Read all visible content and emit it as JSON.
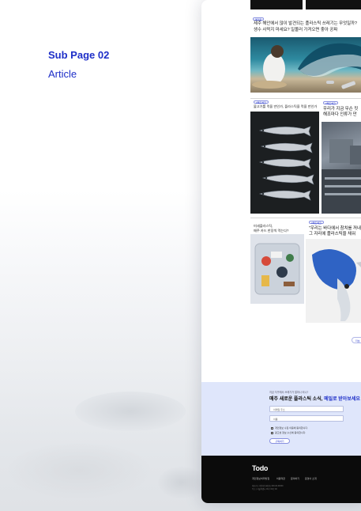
{
  "presentation": {
    "subpage_label": "Sub Page 02",
    "page_name": "Article"
  },
  "articles": {
    "first": {
      "tag": "매거진",
      "title_line1": "제주 해안에서 많이 발견되는 플라스틱 쓰레기는 무엇일까?",
      "title_line2": "생수 사먹지 마세요? 일몰러 가져오면 좋아 공짜"
    },
    "second_left": {
      "tag": "#팩트체크",
      "title": "불고기를 먹을 만인가, 플라스틱을 먹을 만인가"
    },
    "second_right": {
      "tag": "#팩트체크",
      "title_line1": "우리가 지금 무슨 짓",
      "title_line2": "해조마다 인류가 만"
    },
    "third_left": {
      "tag": "#팩트체크",
      "title_line1": "미세플라스틱,",
      "title_line2": "매주 카드 한장씩 먹는다?"
    },
    "third_right": {
      "tag": "#팩트체크",
      "title_line1": "\"우리는 바다에서 참치를 꺼내",
      "title_line2": "그 자리에 플라스틱을 채워"
    },
    "more_label": "더보"
  },
  "newsletter": {
    "subtitle": "지금 지구에서 쓰레기가 얼마나 되니?",
    "title_prefix": "매주 새로운 플라스틱 소식, ",
    "title_highlight": "메일로 받아보세요",
    "email_placeholder": "이메일 주소",
    "name_placeholder": "이름",
    "consent_1": "개인정보 수집 이용에 동의합니다.",
    "consent_2": "광고성 정보 수신에 동의합니다.",
    "submit_label": "구독하기"
  },
  "footer": {
    "logo": "Todo",
    "nav": [
      "개인정보처리방침",
      "이용약관",
      "문의하기",
      "운영사 소개"
    ],
    "info_line1": "대표자 | 사업자등록번호 000-00-00000",
    "info_line2": "주소 | 서울특별시 00구 00로 00"
  }
}
